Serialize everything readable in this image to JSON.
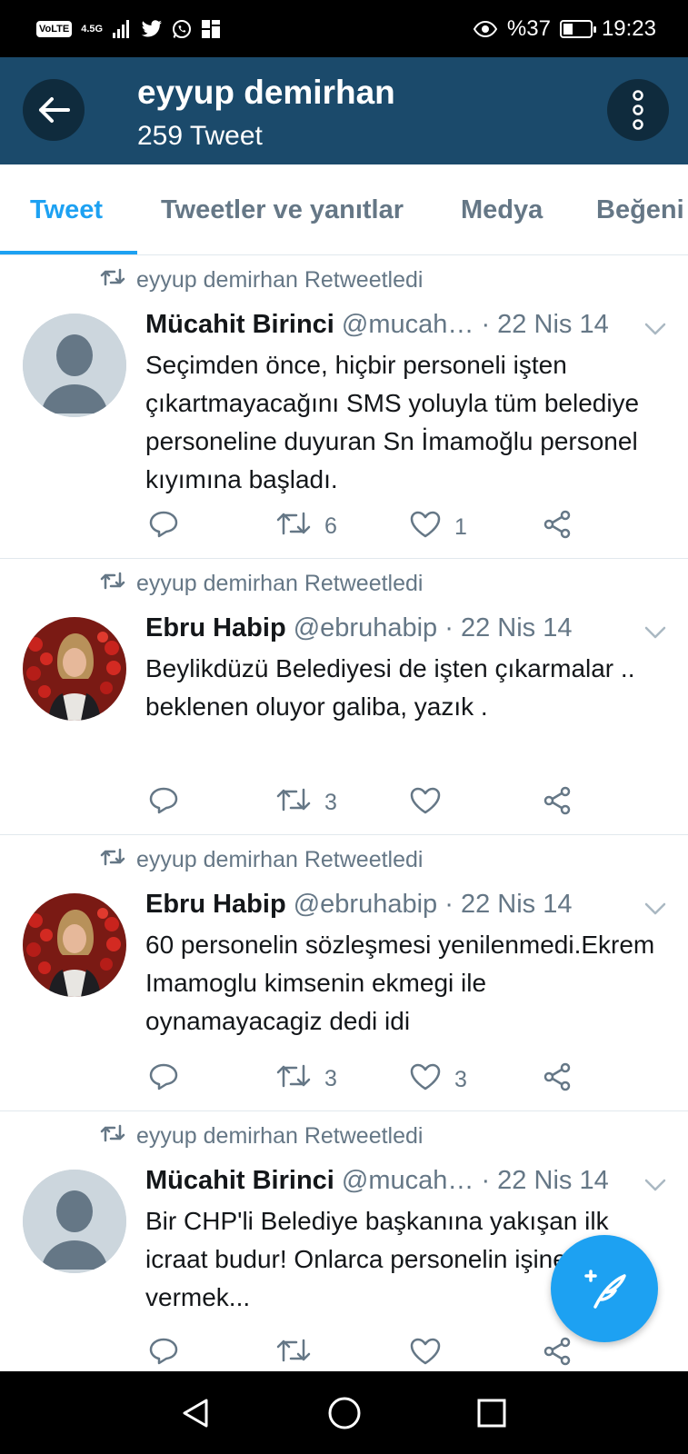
{
  "status_bar": {
    "carrier_badge": "VoLTE",
    "network": "4.5G",
    "battery_label": "%37",
    "battery_level": 0.37,
    "time": "19:23",
    "icons": [
      "volte-icon",
      "signal-icon",
      "twitter-icon",
      "whatsapp-icon",
      "app-icon",
      "eye-comfort-icon",
      "battery-icon"
    ]
  },
  "app_bar": {
    "title": "eyyup demirhan",
    "subtitle": "259 Tweet"
  },
  "tabs": [
    {
      "label": "Tweet",
      "active": true
    },
    {
      "label": "Tweetler ve yanıtlar",
      "active": false
    },
    {
      "label": "Medya",
      "active": false
    },
    {
      "label": "Beğeni",
      "active": false
    }
  ],
  "tweets": [
    {
      "retweet_label": "eyyup demirhan Retweetledi",
      "name": "Mücahit Birinci",
      "handle": "@mucah…",
      "date": "· 22 Nis 14",
      "text": "Seçimden önce, hiçbir personeli işten çıkartmayacağını SMS yoluyla tüm belediye personeline duyuran Sn İmamoğlu personel kıyımına başladı.",
      "replies": "",
      "retweets": "6",
      "likes": "1"
    },
    {
      "retweet_label": "eyyup demirhan Retweetledi",
      "name": "Ebru Habip",
      "handle": "@ebruhabip",
      "date": "· 22 Nis 14",
      "text": "Beylikdüzü Belediyesi de işten çıkarmalar .. beklenen oluyor galiba, yazık .",
      "replies": "",
      "retweets": "3",
      "likes": ""
    },
    {
      "retweet_label": "eyyup demirhan Retweetledi",
      "name": "Ebru Habip",
      "handle": "@ebruhabip",
      "date": "· 22 Nis 14",
      "text": "60 personelin sözleşmesi yenilenmedi.Ekrem Imamoglu kimsenin ekmegi ile oynamayacagiz dedi idi",
      "replies": "",
      "retweets": "3",
      "likes": "3"
    },
    {
      "retweet_label": "eyyup demirhan Retweetledi",
      "name": "Mücahit Birinci",
      "handle": "@mucah…",
      "date": "· 22 Nis 14",
      "text": "Bir CHP'li Belediye başkanına yakışan ilk icraat budur! Onlarca personelin işine son vermek...",
      "replies": "",
      "retweets": "",
      "likes": ""
    }
  ],
  "colors": {
    "app_bar": "#1b4a6b",
    "accent": "#1da1f2",
    "muted": "#657786"
  }
}
